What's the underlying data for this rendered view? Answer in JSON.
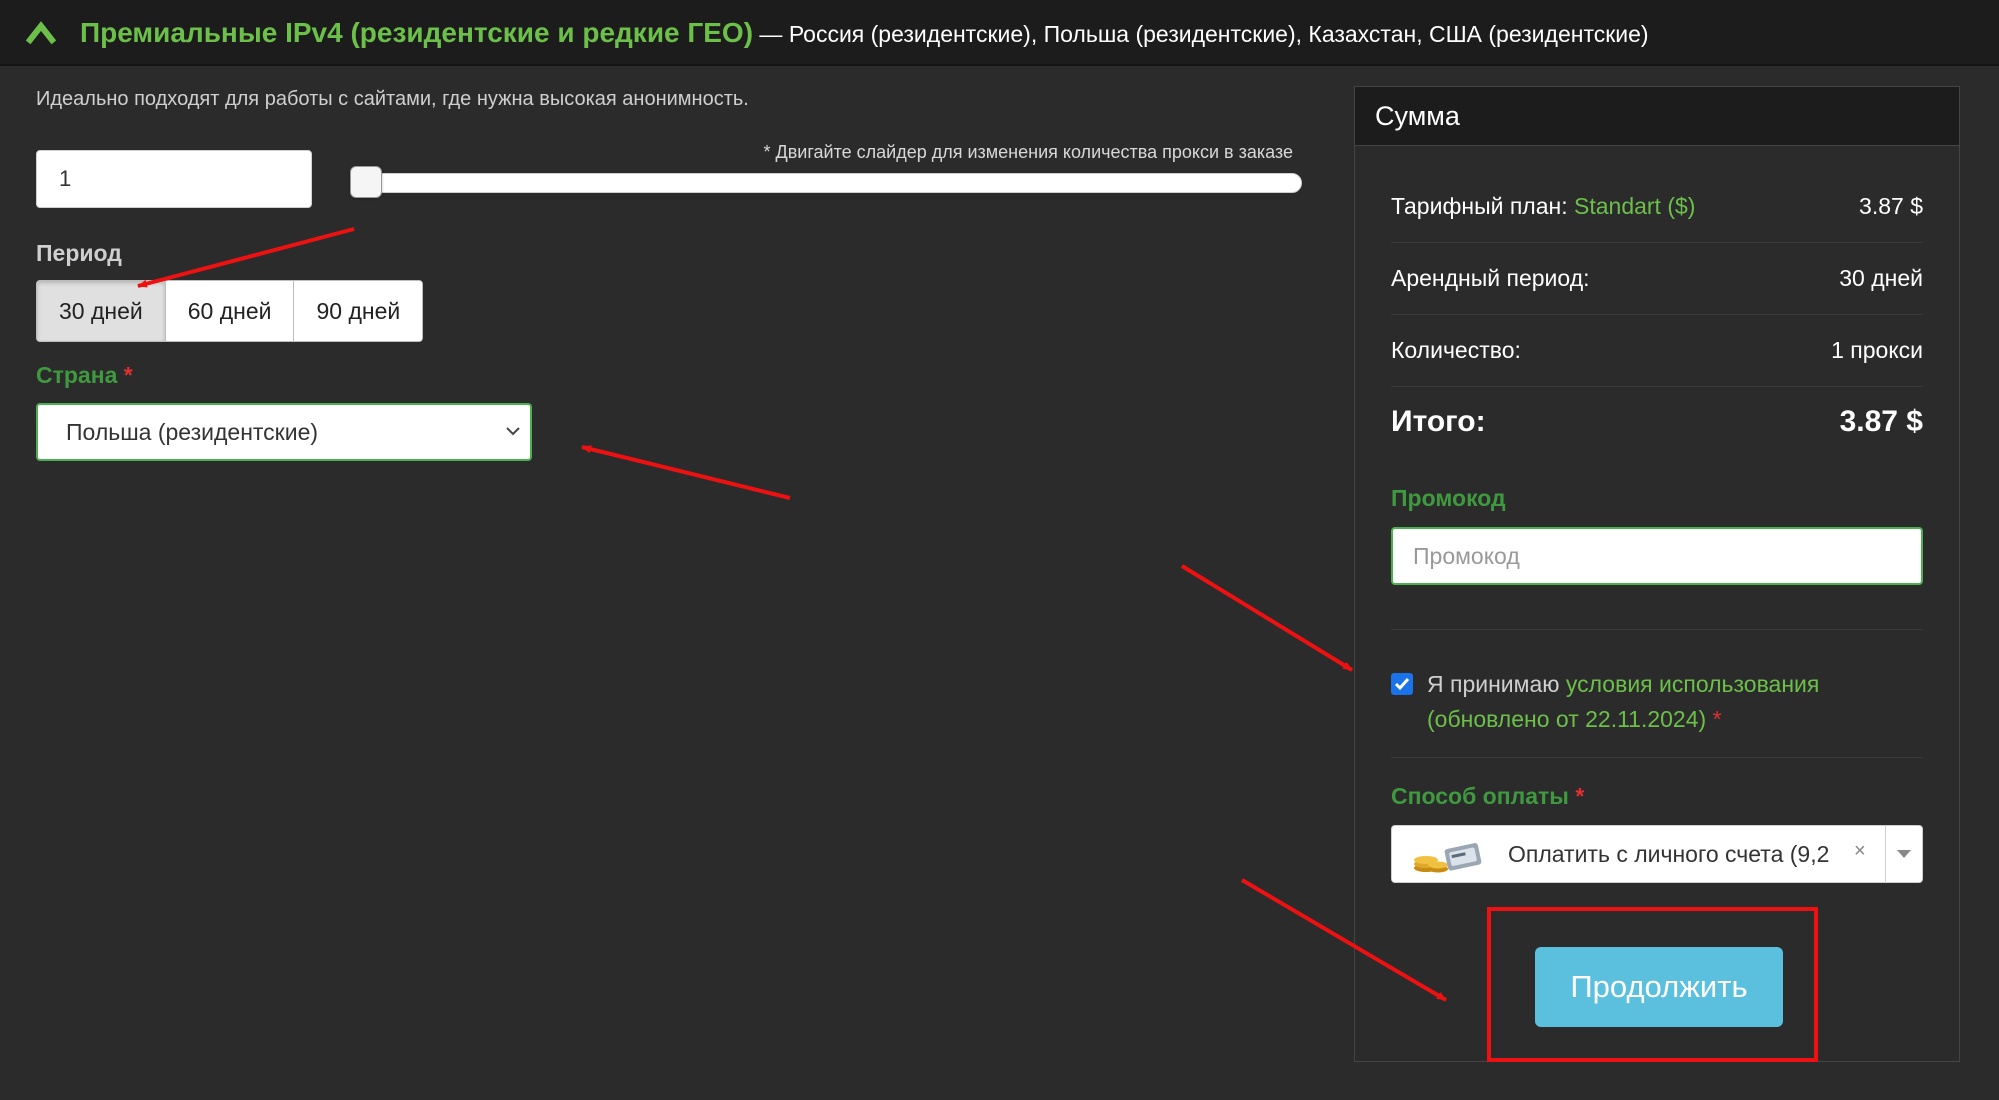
{
  "header": {
    "title": "Премиальные IPv4 (резидентские и редкие ГЕО)",
    "subtitle": " — Россия (резидентские), Польша (резидентские), Казахстан, США (резидентские)",
    "collapse_icon": "chevron-up-icon"
  },
  "description": "Идеально подходят для работы с сайтами, где нужна высокая анонимность.",
  "quantity": {
    "value": "1",
    "slider_hint": "* Двигайте слайдер для изменения количества прокси в заказе",
    "slider_value": 1
  },
  "period": {
    "label": "Период",
    "options": [
      "30 дней",
      "60 дней",
      "90 дней"
    ],
    "selected": "30 дней"
  },
  "country": {
    "label": "Страна",
    "required_mark": "*",
    "selected": "Польша (резидентские)"
  },
  "summary": {
    "title": "Сумма",
    "plan_label": "Тарифный план:",
    "plan_name": "Standart ($)",
    "plan_price": "3.87 $",
    "period_label": "Арендный период:",
    "period_value": "30 дней",
    "qty_label": "Количество:",
    "qty_value": "1 прокси",
    "total_label": "Итого:",
    "total_value": "3.87 $",
    "promo_label": "Промокод",
    "promo_placeholder": "Промокод",
    "terms_prefix": "Я принимаю ",
    "terms_link": "условия использования (обновлено от 22.11.2024)",
    "terms_required": " *",
    "terms_checked": true,
    "payment_label": "Способ оплаты",
    "payment_required": "*",
    "payment_selected": "Оплатить с личного счета (9,2",
    "payment_clear": "×",
    "continue_label": "Продолжить"
  },
  "colors": {
    "accent_green": "#6cc04a",
    "label_green": "#3f9a3f",
    "button_blue": "#5bc0de",
    "annotation_red": "#e11111",
    "background": "#2b2b2b"
  }
}
